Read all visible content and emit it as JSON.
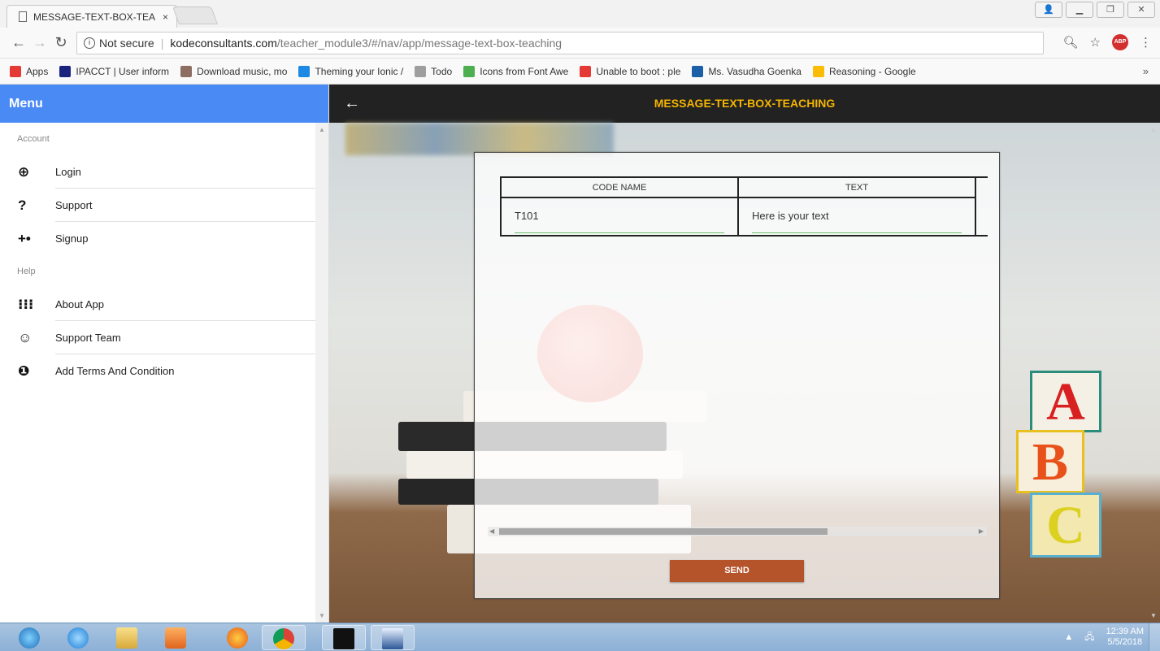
{
  "browser": {
    "tab_title": "MESSAGE-TEXT-BOX-TEA",
    "tab_close": "×",
    "security_label": "Not secure",
    "url_host": "kodeconsultants.com",
    "url_path": "/teacher_module3/#/nav/app/message-text-box-teaching",
    "bookmarks": [
      {
        "label": "Apps",
        "icon": "apps-grid-icon",
        "color": "#e53935"
      },
      {
        "label": "IPACCT | User inform",
        "icon": "ipacct-icon",
        "color": "#1a237e"
      },
      {
        "label": "Download music, mo",
        "icon": "music-icon",
        "color": "#8d6e63"
      },
      {
        "label": "Theming your Ionic /",
        "icon": "ionic-icon",
        "color": "#1e88e5"
      },
      {
        "label": "Todo",
        "icon": "page-icon",
        "color": "#9e9e9e"
      },
      {
        "label": "Icons from Font Awe",
        "icon": "w3-icon",
        "color": "#4caf50"
      },
      {
        "label": "Unable to boot : ple",
        "icon": "youtube-icon",
        "color": "#e53935"
      },
      {
        "label": "Ms. Vasudha Goenka",
        "icon": "p-icon",
        "color": "#1a5fa8"
      },
      {
        "label": "Reasoning - Google",
        "icon": "google-drive-icon",
        "color": "#fbbc05"
      }
    ],
    "bookmarks_more": "»"
  },
  "sidebar": {
    "title": "Menu",
    "sections": [
      {
        "label": "Account",
        "items": [
          {
            "label": "Login",
            "icon": "login-icon",
            "glyph": "⊕"
          },
          {
            "label": "Support",
            "icon": "help-icon",
            "glyph": "?"
          },
          {
            "label": "Signup",
            "icon": "person-add-icon",
            "glyph": "+•"
          }
        ]
      },
      {
        "label": "Help",
        "items": [
          {
            "label": "About App",
            "icon": "apps-icon",
            "glyph": "⁝⁝⁝"
          },
          {
            "label": "Support Team",
            "icon": "smiley-icon",
            "glyph": "☺"
          },
          {
            "label": "Add Terms And Condition",
            "icon": "info-icon",
            "glyph": "❶"
          }
        ]
      }
    ]
  },
  "header": {
    "title": "MESSAGE-TEXT-BOX-TEACHING",
    "back": "←"
  },
  "table": {
    "columns": [
      "CODE NAME",
      "TEXT"
    ],
    "rows": [
      {
        "code_name": "T101",
        "text": "Here is your text"
      }
    ]
  },
  "send_label": "SEND",
  "taskbar": {
    "time": "12:39 AM",
    "date": "5/5/2018"
  },
  "colors": {
    "menu_header": "#4a8af4",
    "title_bar": "#222222",
    "title_text": "#f4b400",
    "send_button": "#b5532a"
  }
}
